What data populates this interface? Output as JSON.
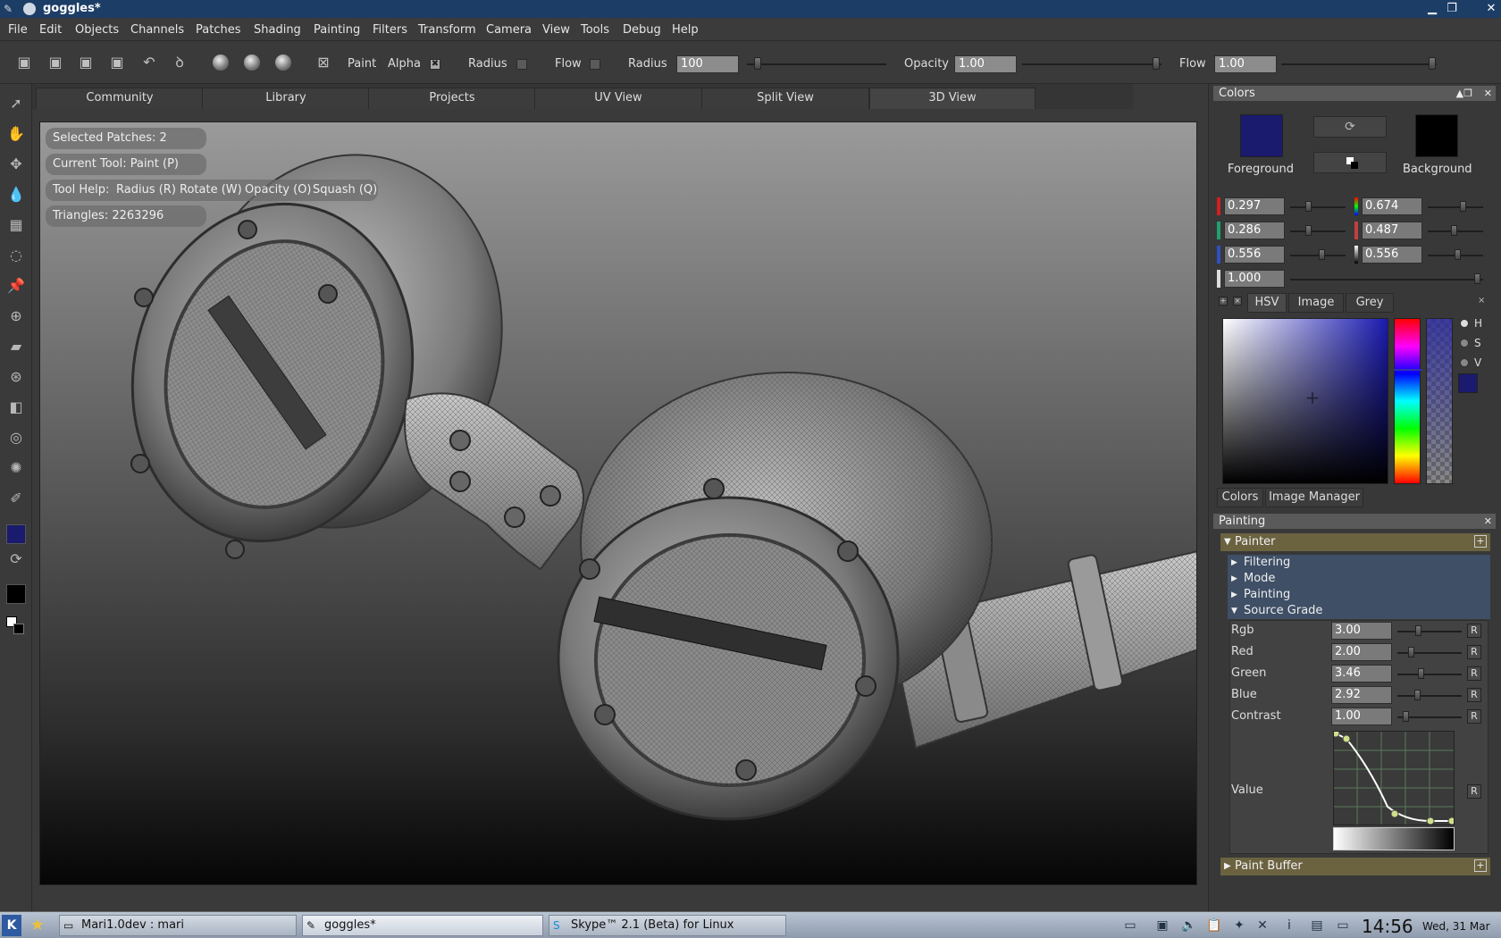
{
  "window": {
    "title": "goggles*"
  },
  "menu": [
    "File",
    "Edit",
    "Objects",
    "Channels",
    "Patches",
    "Shading",
    "Painting",
    "Filters",
    "Transform",
    "Camera",
    "View",
    "Tools",
    "Debug",
    "Help"
  ],
  "toolbar": {
    "paint_label": "Paint",
    "alpha_label": "Alpha",
    "radius_check_label": "Radius",
    "flow_check_label": "Flow",
    "radius_label": "Radius",
    "radius_value": "100",
    "opacity_label": "Opacity",
    "opacity_value": "1.00",
    "flow_label": "Flow",
    "flow_value": "1.00"
  },
  "tabs": [
    "Community",
    "Library",
    "Projects",
    "UV View",
    "Split View",
    "3D View"
  ],
  "active_tab": "3D View",
  "hud": {
    "selected_patches": "Selected Patches: 2",
    "current_tool": "Current Tool: Paint (P)",
    "tool_help": "Tool Help:",
    "help_radius": "Radius (R)",
    "help_rotate": "Rotate (W)",
    "help_opacity": "Opacity (O)",
    "help_squash": "Squash (Q)",
    "triangles": "Triangles: 2263296"
  },
  "colors_panel": {
    "title": "Colors",
    "foreground_label": "Foreground",
    "background_label": "Background",
    "foreground_color": "#1a1a6e",
    "background_color": "#000000",
    "rgb": [
      "0.297",
      "0.286",
      "0.556"
    ],
    "hsv": [
      "0.674",
      "0.487",
      "0.556"
    ],
    "alpha": "1.000",
    "subtabs": [
      "HSV",
      "Image",
      "Grey"
    ],
    "radio_labels": [
      "H",
      "S",
      "V"
    ],
    "bottom_tabs": [
      "Colors",
      "Image Manager"
    ]
  },
  "painting_panel": {
    "title": "Painting",
    "painter": "Painter",
    "items": [
      "Filtering",
      "Mode",
      "Painting",
      "Source Grade"
    ],
    "grade_rows": [
      {
        "label": "Rgb",
        "value": "3.00"
      },
      {
        "label": "Red",
        "value": "2.00"
      },
      {
        "label": "Green",
        "value": "3.46"
      },
      {
        "label": "Blue",
        "value": "2.92"
      },
      {
        "label": "Contrast",
        "value": "1.00"
      }
    ],
    "value_label": "Value",
    "reset_label": "R",
    "paint_buffer": "Paint Buffer"
  },
  "taskbar": {
    "tasks": [
      "Mari1.0dev : mari",
      "goggles*",
      "Skype™ 2.1 (Beta) for Linux"
    ],
    "clock": "14:56",
    "date": "Wed, 31 Mar"
  }
}
